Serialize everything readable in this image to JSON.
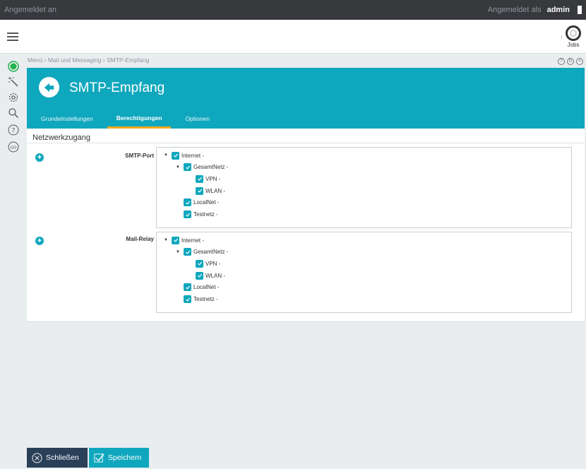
{
  "topbar": {
    "logged_in_label": "Angemeldet an",
    "logged_as_label": "Angemeldet als",
    "user": "admin"
  },
  "header": {
    "jobs_label": "Jobs"
  },
  "breadcrumb": "Menü › Mail und Messaging › SMTP-Empfang",
  "panel": {
    "title": "SMTP-Empfang",
    "tabs": [
      {
        "label": "Grundeinstellungen",
        "active": false
      },
      {
        "label": "Berechtigungen",
        "active": true
      },
      {
        "label": "Optionen",
        "active": false
      }
    ]
  },
  "section": {
    "title": "Netzwerkzugang"
  },
  "fields": [
    {
      "label": "SMTP-Port",
      "tree": [
        {
          "label": "Internet -",
          "level": 0,
          "caret": true
        },
        {
          "label": "GesamtNetz -",
          "level": 1,
          "caret": true
        },
        {
          "label": "VPN -",
          "level": 2,
          "caret": false
        },
        {
          "label": "WLAN -",
          "level": 2,
          "caret": false
        },
        {
          "label": "LocalNet -",
          "level": 1,
          "caret": false
        },
        {
          "label": "Testnetz -",
          "level": 1,
          "caret": false
        }
      ]
    },
    {
      "label": "Mail-Relay",
      "tree": [
        {
          "label": "Internet -",
          "level": 0,
          "caret": true
        },
        {
          "label": "GesamtNetz -",
          "level": 1,
          "caret": true
        },
        {
          "label": "VPN -",
          "level": 2,
          "caret": false
        },
        {
          "label": "WLAN -",
          "level": 2,
          "caret": false
        },
        {
          "label": "LocalNet -",
          "level": 1,
          "caret": false
        },
        {
          "label": "Testnetz -",
          "level": 1,
          "caret": false
        }
      ]
    }
  ],
  "footer": {
    "close_label": "Schließen",
    "save_label": "Speichern"
  },
  "colors": {
    "accent": "#0fa7bd",
    "topbar": "#37393d",
    "close_button": "#2a3f58",
    "tab_indicator": "#f7a81b",
    "status_green": "#22b14c"
  }
}
